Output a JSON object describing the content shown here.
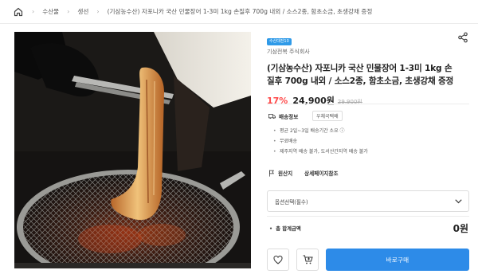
{
  "breadcrumb": {
    "home_icon": "home-icon",
    "items": [
      "수산물",
      "생선",
      "(기삼농수산) 자포니카 국산 민물장어 1-3미 1kg 손질후 700g 내외 / 소스2종, 함초소금, 초생강채 증정"
    ]
  },
  "product": {
    "badge": "수산대전10",
    "seller": "기삼전복 주식회사",
    "title": "(기삼농수산) 자포니카 국산 민물장어 1-3미 1kg 손질후 700g 내외 / 소스2종, 함초소금, 초생강채 증정",
    "discount": "17%",
    "price": "24,900원",
    "original_price": "29,900원"
  },
  "shipping": {
    "label": "배송정보",
    "method": "우체국택배",
    "notes": [
      "평균 2일~3일 배송기간 소요 ⓘ",
      "무료배송",
      "제주지역 배송 불가, 도서산간지역 배송 불가"
    ]
  },
  "origin": {
    "label": "원산지",
    "value": "상세페이지참조"
  },
  "option_select": {
    "placeholder": "옵션선택(필수)"
  },
  "total": {
    "label": "총 합계금액",
    "value": "0원"
  },
  "actions": {
    "buy_label": "바로구매"
  },
  "colors": {
    "accent": "#2d8be8",
    "discount": "#ff4a4a",
    "badge": "#2f9ae8"
  }
}
